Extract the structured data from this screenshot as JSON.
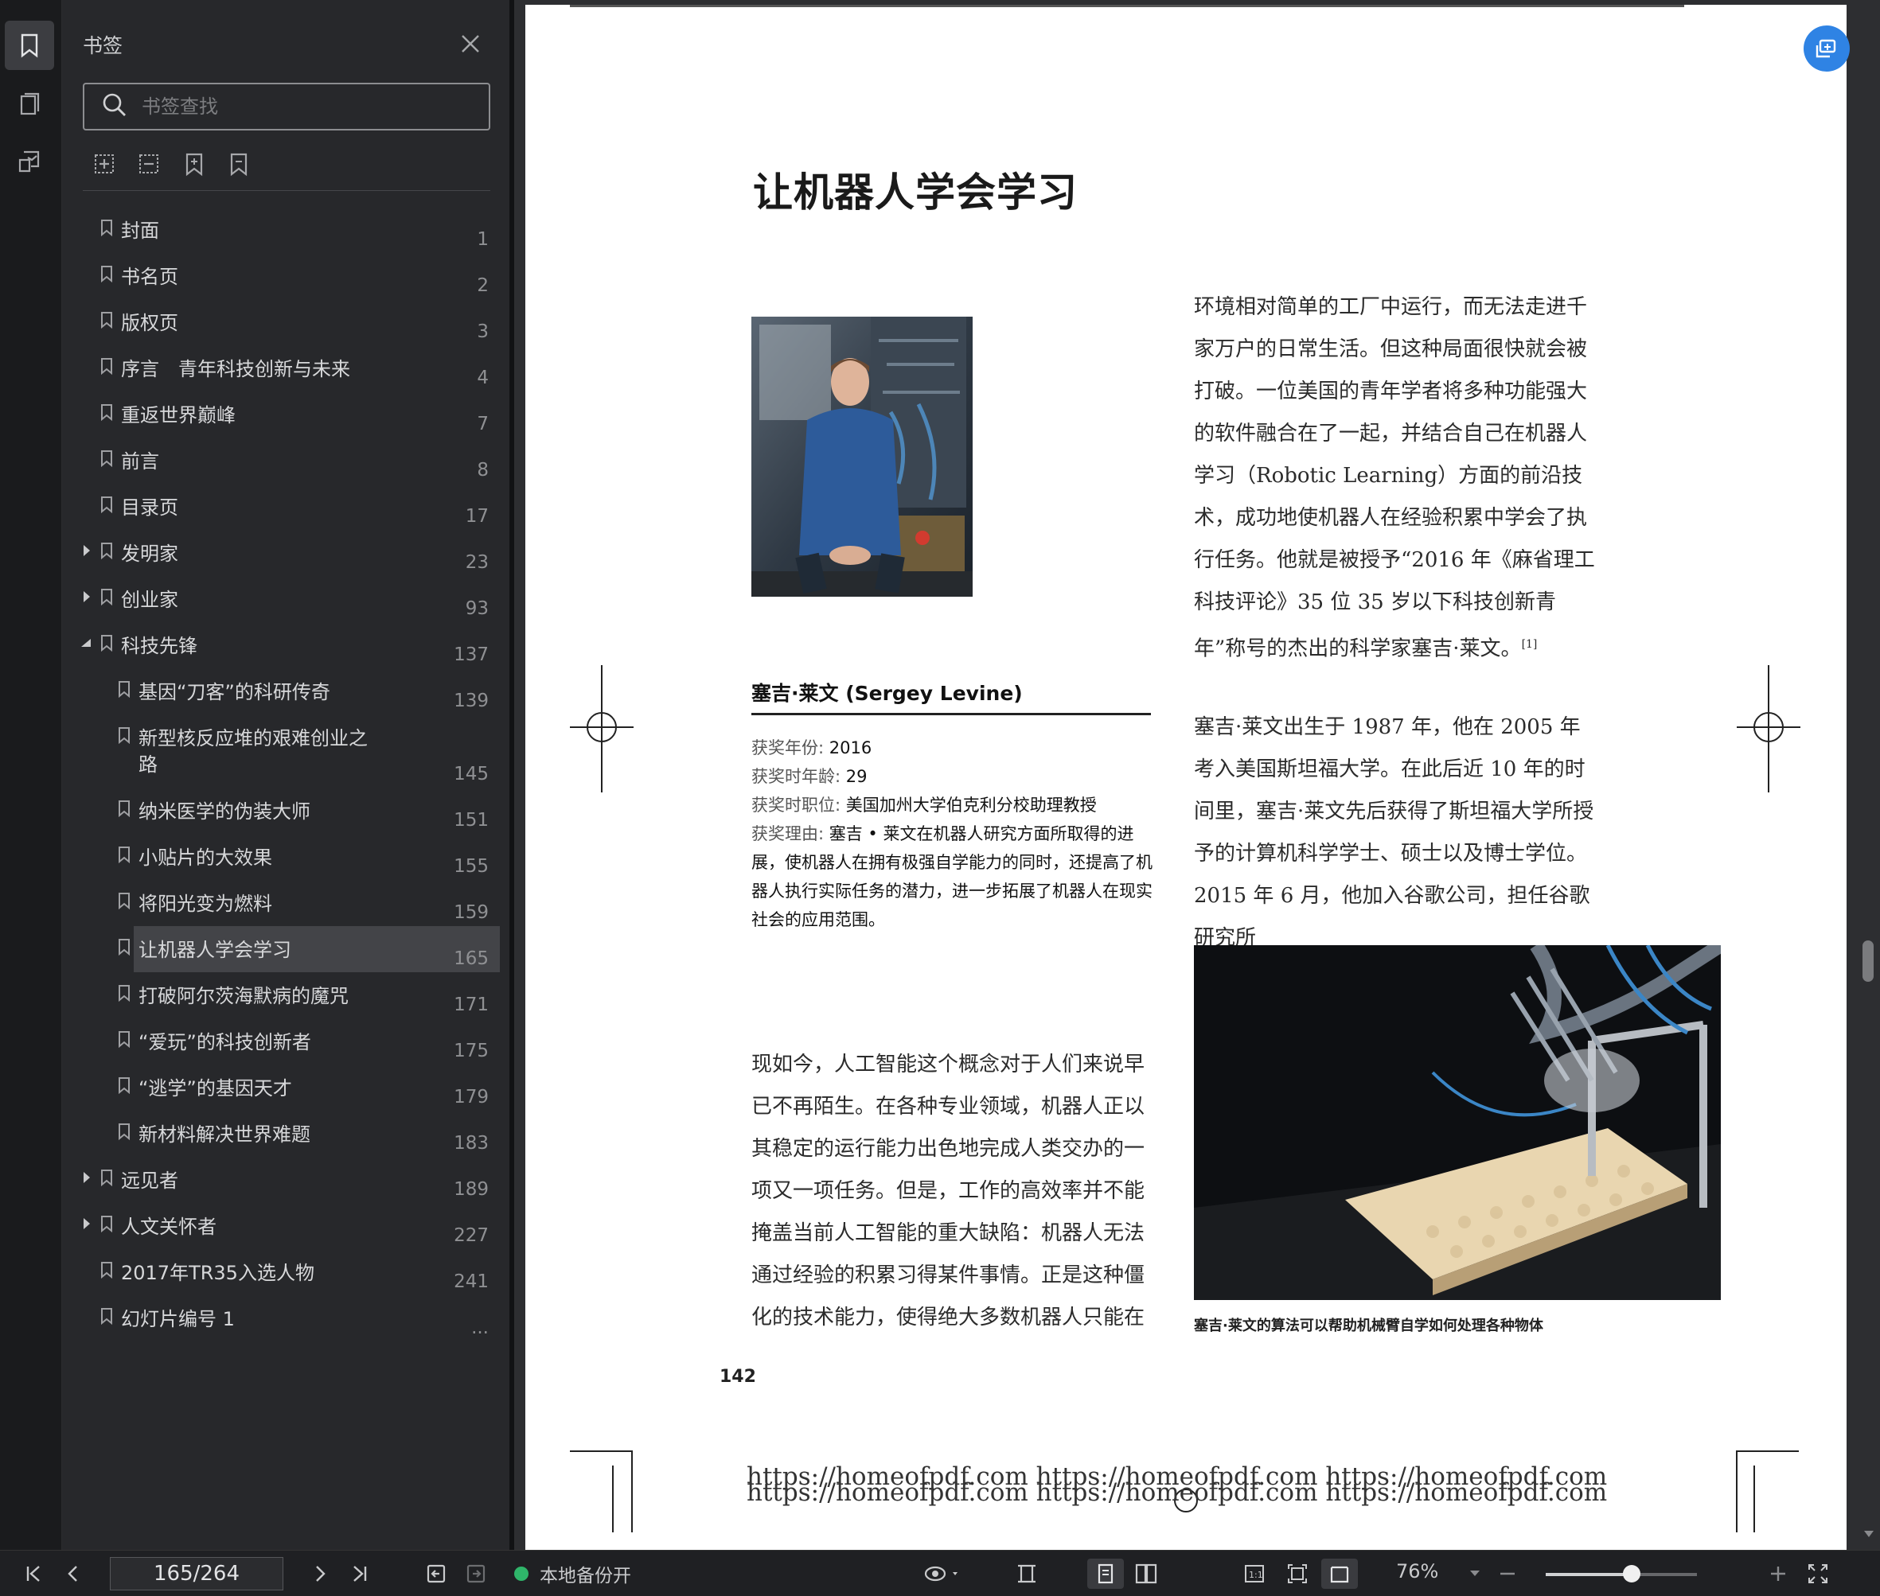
{
  "panel": {
    "title": "书签",
    "search_placeholder": "书签查找"
  },
  "bookmarks": [
    {
      "label": "封面",
      "page": "1",
      "level": 0,
      "expandable": false
    },
    {
      "label": "书名页",
      "page": "2",
      "level": 0,
      "expandable": false
    },
    {
      "label": "版权页",
      "page": "3",
      "level": 0,
      "expandable": false
    },
    {
      "label": "序言　青年科技创新与未来",
      "page": "4",
      "level": 0,
      "expandable": false
    },
    {
      "label": "重返世界巅峰",
      "page": "7",
      "level": 0,
      "expandable": false
    },
    {
      "label": "前言",
      "page": "8",
      "level": 0,
      "expandable": false
    },
    {
      "label": "目录页",
      "page": "17",
      "level": 0,
      "expandable": false
    },
    {
      "label": "发明家",
      "page": "23",
      "level": 0,
      "expandable": "collapsed"
    },
    {
      "label": "创业家",
      "page": "93",
      "level": 0,
      "expandable": "collapsed"
    },
    {
      "label": "科技先锋",
      "page": "137",
      "level": 0,
      "expandable": "expanded"
    },
    {
      "label": "基因“刀客”的科研传奇",
      "page": "139",
      "level": 1,
      "expandable": false
    },
    {
      "label": "新型核反应堆的艰难创业之路",
      "page": "145",
      "level": 1,
      "expandable": false,
      "tall": true
    },
    {
      "label": "纳米医学的伪装大师",
      "page": "151",
      "level": 1,
      "expandable": false
    },
    {
      "label": "小贴片的大效果",
      "page": "155",
      "level": 1,
      "expandable": false
    },
    {
      "label": "将阳光变为燃料",
      "page": "159",
      "level": 1,
      "expandable": false
    },
    {
      "label": "让机器人学会学习",
      "page": "165",
      "level": 1,
      "expandable": false,
      "selected": true
    },
    {
      "label": "打破阿尔茨海默病的魔咒",
      "page": "171",
      "level": 1,
      "expandable": false
    },
    {
      "label": "“爱玩”的科技创新者",
      "page": "175",
      "level": 1,
      "expandable": false
    },
    {
      "label": "“逃学”的基因天才",
      "page": "179",
      "level": 1,
      "expandable": false
    },
    {
      "label": "新材料解决世界难题",
      "page": "183",
      "level": 1,
      "expandable": false
    },
    {
      "label": "远见者",
      "page": "189",
      "level": 0,
      "expandable": "collapsed"
    },
    {
      "label": "人文关怀者",
      "page": "227",
      "level": 0,
      "expandable": "collapsed"
    },
    {
      "label": "2017年TR35入选人物",
      "page": "241",
      "level": 0,
      "expandable": false
    },
    {
      "label": "幻灯片编号 1",
      "page": "...",
      "level": 0,
      "expandable": false
    }
  ],
  "doc": {
    "title": "让机器人学会学习",
    "person_name": "塞吉·莱文 (Sergey Levine)",
    "award_year_k": "获奖年份:",
    "award_year_v": " 2016",
    "award_age_k": "获奖时年龄:",
    "award_age_v": " 29",
    "award_pos_k": "获奖时职位:",
    "award_pos_v": " 美国加州大学伯克利分校助理教授",
    "award_reason_k": "获奖理由:",
    "award_reason_v": " 塞吉 • 莱文在机器人研究方面所取得的进展，使机器人在拥有极强自学能力的同时，还提高了机器人执行实际任务的潜力，进一步拓展了机器人在现实社会的应用范围。",
    "right_para1": "环境相对简单的工厂中运行，而无法走进千家万户的日常生活。但这种局面很快就会被打破。一位美国的青年学者将多种功能强大的软件融合在了一起，并结合自己在机器人学习（Robotic Learning）方面的前沿技术，成功地使机器人在经验积累中学会了执行任务。他就是被授予“2016 年《麻省理工科技评论》35 位 35 岁以下科技创新青年”称号的杰出的科学家塞吉·莱文。",
    "footnote": "[1]",
    "right_para2": "塞吉·莱文出生于 1987 年，他在 2005 年考入美国斯坦福大学。在此后近 10 年的时间里，塞吉·莱文先后获得了斯坦福大学所授予的计算机科学学士、硕士以及博士学位。2015 年 6 月，他加入谷歌公司，担任谷歌研究所",
    "left_para": "现如今，人工智能这个概念对于人们来说早已不再陌生。在各种专业领域，机器人正以其稳定的运行能力出色地完成人类交办的一项又一项任务。但是，工作的高效率并不能掩盖当前人工智能的重大缺陷：机器人无法通过经验的积累习得某件事情。正是这种僵化的技术能力，使得绝大多数机器人只能在",
    "caption": "塞吉·莱文的算法可以帮助机械臂自学如何处理各种物体",
    "page_number": "142",
    "watermark1": "https://homeofpdf.com https://homeofpdf.com https://homeofpdf.com",
    "watermark2": "https://homeofpdf.com https://homeofpdf.com https://homeofpdf.com"
  },
  "statusbar": {
    "page_indicator": "165/264",
    "backup_label": "本地备份开",
    "zoom": "76%",
    "zoom_fraction": 0.57
  },
  "colors": {
    "accent": "#2f83e4",
    "backup_dot": "#2fb56a",
    "panel_bg": "#27282b",
    "selected_bg": "#434448"
  }
}
